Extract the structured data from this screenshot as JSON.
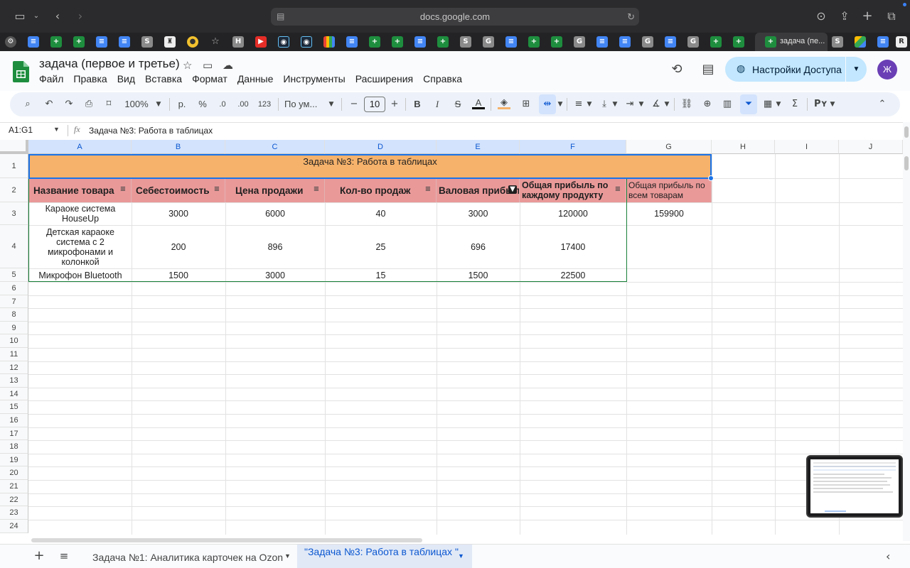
{
  "browser": {
    "url": "docs.google.com",
    "active_tab_title": "задача (пе...",
    "tab_favicons": [
      "gear",
      "doc",
      "sheet",
      "sheet",
      "doc",
      "doc",
      "S",
      "cambridge",
      "duck",
      "star",
      "H",
      "youtube",
      "steam",
      "steam",
      "multi",
      "doc",
      "sheet",
      "sheet",
      "doc",
      "sheet",
      "G",
      "doc",
      "sheet",
      "G",
      "doc",
      "G",
      "doc",
      "G",
      "sheet",
      "sheet",
      "S",
      "drive",
      "doc",
      "R"
    ]
  },
  "document": {
    "title": "задача (первое и третье)",
    "menu": [
      "Файл",
      "Правка",
      "Вид",
      "Вставка",
      "Формат",
      "Данные",
      "Инструменты",
      "Расширения",
      "Справка"
    ],
    "share_label": "Настройки Доступа",
    "avatar_letter": "Ж"
  },
  "toolbar": {
    "zoom": "100%",
    "currency": "р.",
    "percent": "%",
    "dec_decrease": ".0",
    "dec_increase": ".00",
    "number_format": "123",
    "font_name": "По ум...",
    "font_size": "10",
    "bold": "B",
    "italic": "I",
    "strikethrough": "S",
    "text_color": "A"
  },
  "formula_bar": {
    "name_box": "A1:G1",
    "fx": "fx",
    "content": "Задача №3: Работа в таблицах"
  },
  "grid": {
    "columns": [
      "A",
      "B",
      "C",
      "D",
      "E",
      "F",
      "G",
      "H",
      "I",
      "J"
    ],
    "rows": [
      "1",
      "2",
      "3",
      "4",
      "5",
      "6",
      "7",
      "8",
      "9",
      "10",
      "11",
      "12",
      "13",
      "14",
      "15",
      "16",
      "17",
      "18",
      "19",
      "20",
      "21",
      "22",
      "23",
      "24"
    ],
    "title": "Задача №3: Работа в таблицах",
    "headers": [
      "Название товара",
      "Себестоимость",
      "Цена продажи",
      "Кол-во продаж",
      "Валовая прибыль",
      "Общая прибыль по каждому продукту",
      "Общая прибыль по всем товарам"
    ],
    "data_rows": [
      [
        "Караоке система HouseUp",
        "3000",
        "6000",
        "40",
        "3000",
        "120000",
        "159900"
      ],
      [
        "Детская караоке система с 2 микрофонами и колонкой",
        "200",
        "896",
        "25",
        "696",
        "17400",
        ""
      ],
      [
        "Микрофон Bluetooth",
        "1500",
        "3000",
        "15",
        "1500",
        "22500",
        ""
      ]
    ]
  },
  "sheets": {
    "tab1": "Задача №1: Аналитика карточек на Ozon",
    "tab2": "\"Задача №3: Работа в таблицах \""
  },
  "colors": {
    "title_fill": "#f6b26b",
    "header_fill": "#ea9999",
    "selection": "#1a73e8",
    "share_button": "#c2e7ff"
  }
}
